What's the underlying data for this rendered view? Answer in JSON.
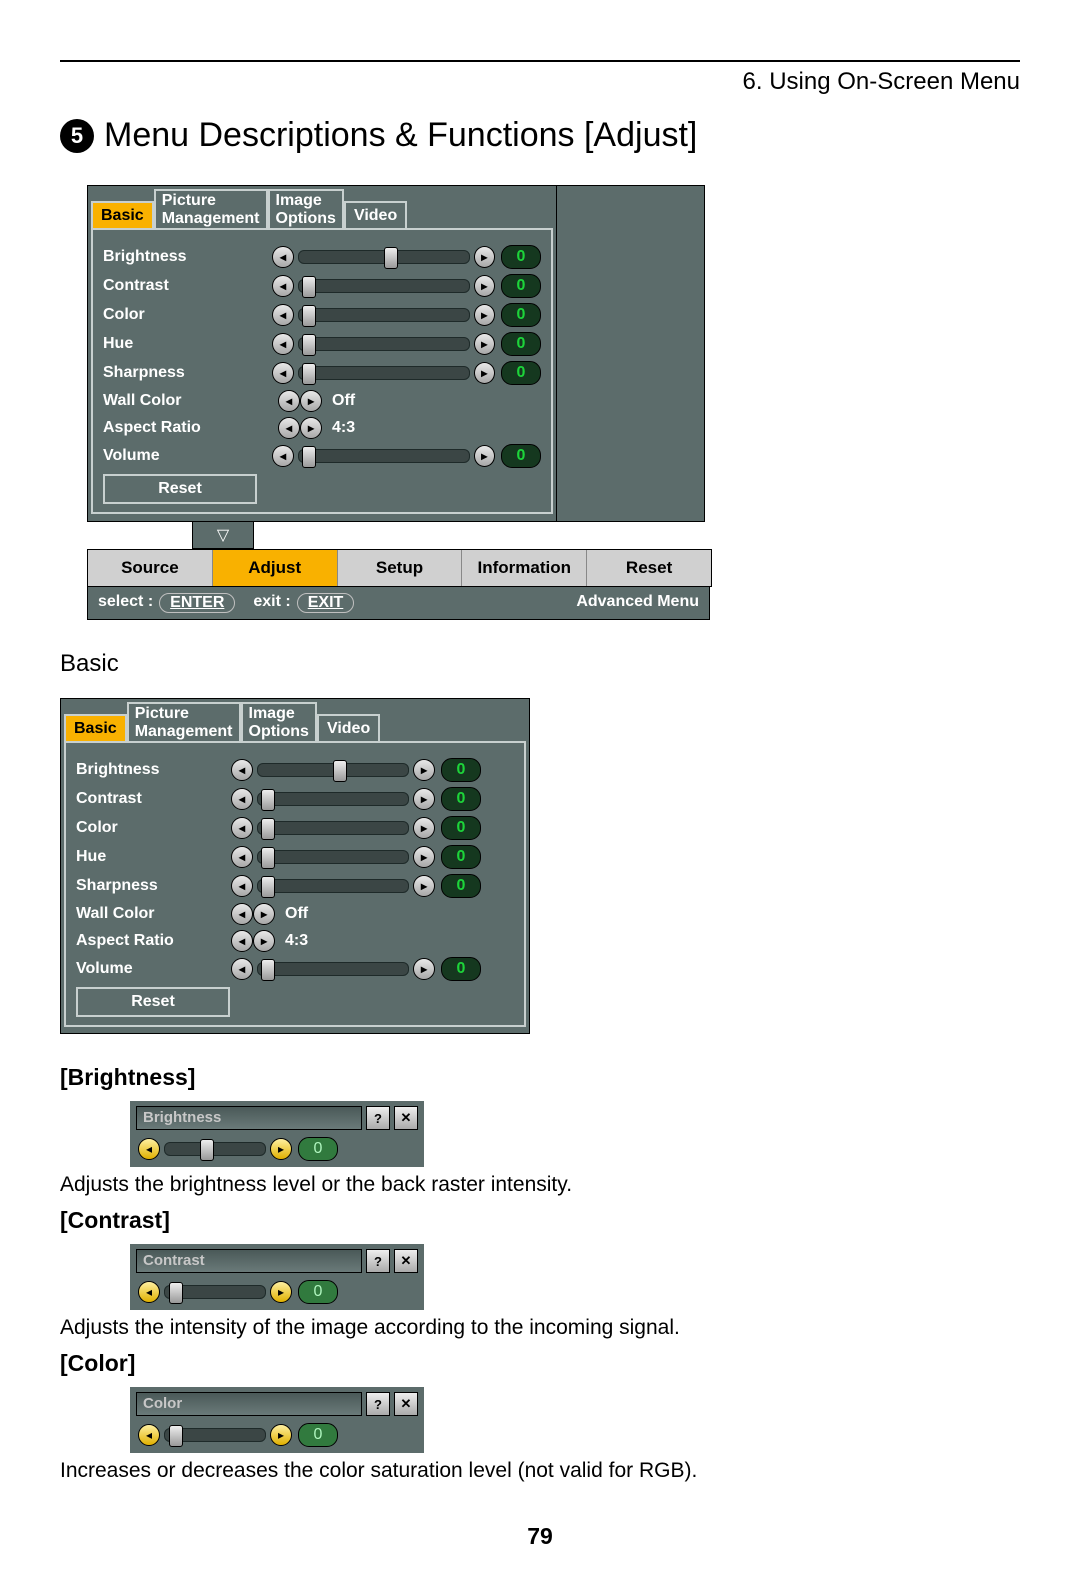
{
  "chapter": "6. Using On-Screen Menu",
  "section_number": "5",
  "section_title": "Menu Descriptions & Functions [Adjust]",
  "page_number": "79",
  "adjust_tabs": {
    "basic": "Basic",
    "pic_mgmt_l1": "Picture",
    "pic_mgmt_l2": "Management",
    "img_opt_l1": "Image",
    "img_opt_l2": "Options",
    "video": "Video"
  },
  "adjust_rows": {
    "brightness": {
      "label": "Brightness",
      "value": "0"
    },
    "contrast": {
      "label": "Contrast",
      "value": "0"
    },
    "color": {
      "label": "Color",
      "value": "0"
    },
    "hue": {
      "label": "Hue",
      "value": "0"
    },
    "sharpness": {
      "label": "Sharpness",
      "value": "0"
    },
    "wall_color": {
      "label": "Wall Color",
      "value": "Off"
    },
    "aspect": {
      "label": "Aspect Ratio",
      "value": "4:3"
    },
    "volume": {
      "label": "Volume",
      "value": "0"
    },
    "reset": {
      "label": "Reset"
    }
  },
  "main_tabs": {
    "source": "Source",
    "adjust": "Adjust",
    "setup": "Setup",
    "info": "Information",
    "reset": "Reset"
  },
  "helpbar": {
    "select_lbl": "select :",
    "select_btn": "ENTER",
    "exit_lbl": "exit :",
    "exit_btn": "EXIT",
    "mode": "Advanced Menu"
  },
  "basic_heading": "Basic",
  "brightness_h": "[Brightness]",
  "brightness_desc": "Adjusts the brightness level or the back raster intensity.",
  "contrast_h": "[Contrast]",
  "contrast_desc": "Adjusts the intensity of the image according to the incoming signal.",
  "color_h": "[Color]",
  "color_desc": "Increases or decreases the color saturation level (not valid for RGB).",
  "popup": {
    "brightness": {
      "title": "Brightness",
      "value": "0"
    },
    "contrast": {
      "title": "Contrast",
      "value": "0"
    },
    "color": {
      "title": "Color",
      "value": "0"
    }
  }
}
